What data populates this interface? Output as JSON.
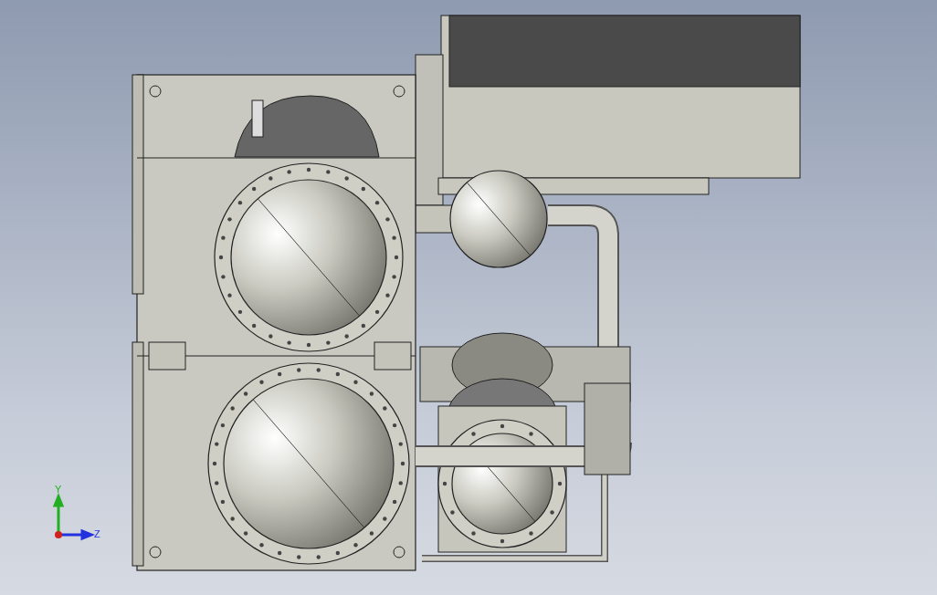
{
  "view_triad": {
    "axes": [
      {
        "label": "Y",
        "color": "#22b022"
      },
      {
        "label": "Z",
        "color": "#2233dd"
      }
    ]
  }
}
